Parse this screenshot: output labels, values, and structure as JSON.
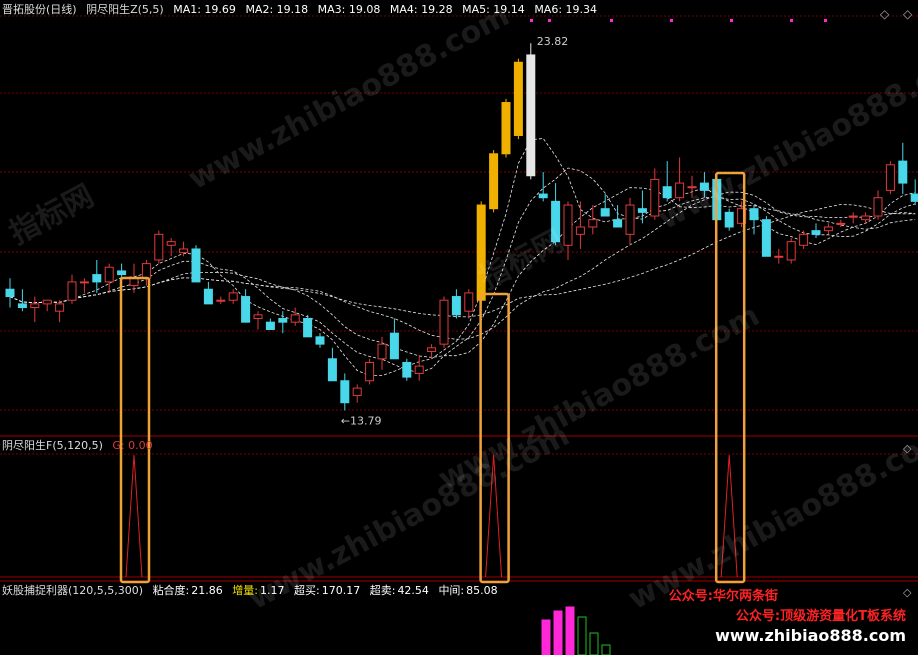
{
  "colors": {
    "up": "#e03a3a",
    "down": "#49d7ea",
    "gold": "#f0b000",
    "white": "#e6e6e6",
    "grid": "#7a0000",
    "box": "#f0a23a",
    "pink": "#ff27d8",
    "green": "#22c022",
    "magenta": "#ff2ad6"
  },
  "main_panel": {
    "title": "晋拓股份(日线)",
    "indicator": "阴尽阳生Z(5,5)",
    "ma": [
      "MA1: 19.69",
      "MA2: 19.18",
      "MA3: 19.08",
      "MA4: 19.28",
      "MA5: 19.14",
      "MA6: 19.34"
    ],
    "high_label": "23.82",
    "low_label": "←13.79"
  },
  "signal_panel": {
    "title": "阴尽阳生F(5,120,5)",
    "value_label": "G: 0.00"
  },
  "bottom_panel": {
    "title": "妖股捕捉利器(120,5,5,300)",
    "stats": [
      {
        "label": "粘合度:",
        "value": "21.86"
      },
      {
        "label": "增量:",
        "value": "1.17"
      },
      {
        "label": "超买:",
        "value": "170.17"
      },
      {
        "label": "超卖:",
        "value": "42.54"
      },
      {
        "label": "中间:",
        "value": "85.08"
      }
    ]
  },
  "promo": {
    "line1": "公众号:华尔两条街",
    "line2": "公众号:顶级游资量化T板系统",
    "line3": "www.zhibiao888.com"
  },
  "watermarks": [
    "www.zhibiao888.com",
    "www.zhibiao888.com",
    "指标网",
    "www.zhibiao888.com",
    "www.zhibiao888.com",
    "指标网",
    "www.zhibiao888.com"
  ],
  "chart_data": {
    "type": "candlestick",
    "y_labels_visible": [
      "23.82",
      "13.79"
    ],
    "candles": [
      {
        "o": 17.1,
        "h": 17.4,
        "l": 16.6,
        "c": 16.9
      },
      {
        "o": 16.7,
        "h": 17.1,
        "l": 16.5,
        "c": 16.6
      },
      {
        "o": 16.6,
        "h": 16.9,
        "l": 16.2,
        "c": 16.7
      },
      {
        "o": 16.7,
        "h": 16.8,
        "l": 16.5,
        "c": 16.8
      },
      {
        "o": 16.5,
        "h": 16.8,
        "l": 16.2,
        "c": 16.7
      },
      {
        "o": 16.8,
        "h": 17.5,
        "l": 16.7,
        "c": 17.3
      },
      {
        "o": 17.3,
        "h": 17.4,
        "l": 17.0,
        "c": 17.3
      },
      {
        "o": 17.5,
        "h": 17.9,
        "l": 17.0,
        "c": 17.3
      },
      {
        "o": 17.3,
        "h": 17.8,
        "l": 17.0,
        "c": 17.7
      },
      {
        "o": 17.6,
        "h": 17.8,
        "l": 17.4,
        "c": 17.5
      },
      {
        "o": 17.2,
        "h": 17.8,
        "l": 17.0,
        "c": 17.4
      },
      {
        "o": 17.4,
        "h": 17.9,
        "l": 17.2,
        "c": 17.8
      },
      {
        "o": 17.9,
        "h": 18.7,
        "l": 17.8,
        "c": 18.6
      },
      {
        "o": 18.3,
        "h": 18.5,
        "l": 18.0,
        "c": 18.4
      },
      {
        "o": 18.1,
        "h": 18.4,
        "l": 18.0,
        "c": 18.2
      },
      {
        "o": 18.2,
        "h": 18.3,
        "l": 17.3,
        "c": 17.3
      },
      {
        "o": 17.1,
        "h": 17.3,
        "l": 16.7,
        "c": 16.7
      },
      {
        "o": 16.8,
        "h": 16.9,
        "l": 16.7,
        "c": 16.8
      },
      {
        "o": 16.8,
        "h": 17.1,
        "l": 16.7,
        "c": 17.0
      },
      {
        "o": 16.9,
        "h": 17.1,
        "l": 16.2,
        "c": 16.2
      },
      {
        "o": 16.3,
        "h": 16.5,
        "l": 16.0,
        "c": 16.4
      },
      {
        "o": 16.2,
        "h": 16.3,
        "l": 16.0,
        "c": 16.0
      },
      {
        "o": 16.3,
        "h": 16.5,
        "l": 15.9,
        "c": 16.2
      },
      {
        "o": 16.2,
        "h": 16.6,
        "l": 16.1,
        "c": 16.4
      },
      {
        "o": 16.3,
        "h": 16.4,
        "l": 15.8,
        "c": 15.8
      },
      {
        "o": 15.8,
        "h": 15.9,
        "l": 15.5,
        "c": 15.6
      },
      {
        "o": 15.2,
        "h": 15.5,
        "l": 14.6,
        "c": 14.6
      },
      {
        "o": 14.6,
        "h": 14.8,
        "l": 13.79,
        "c": 14.0
      },
      {
        "o": 14.2,
        "h": 14.5,
        "l": 14.0,
        "c": 14.4
      },
      {
        "o": 14.6,
        "h": 15.2,
        "l": 14.5,
        "c": 15.1
      },
      {
        "o": 15.2,
        "h": 15.8,
        "l": 14.9,
        "c": 15.6
      },
      {
        "o": 15.9,
        "h": 16.3,
        "l": 15.2,
        "c": 15.2
      },
      {
        "o": 15.1,
        "h": 15.2,
        "l": 14.6,
        "c": 14.7
      },
      {
        "o": 14.8,
        "h": 15.3,
        "l": 14.6,
        "c": 15.0
      },
      {
        "o": 15.4,
        "h": 15.6,
        "l": 15.2,
        "c": 15.5
      },
      {
        "o": 15.6,
        "h": 16.9,
        "l": 15.5,
        "c": 16.8
      },
      {
        "o": 16.9,
        "h": 17.1,
        "l": 16.3,
        "c": 16.4
      },
      {
        "o": 16.5,
        "h": 17.1,
        "l": 16.3,
        "c": 17.0
      },
      {
        "o": 16.8,
        "h": 19.5,
        "l": 16.7,
        "c": 19.4
      },
      {
        "o": 19.3,
        "h": 20.9,
        "l": 19.2,
        "c": 20.8
      },
      {
        "o": 20.8,
        "h": 22.3,
        "l": 20.7,
        "c": 22.2
      },
      {
        "o": 21.3,
        "h": 23.4,
        "l": 21.2,
        "c": 23.3
      },
      {
        "o": 23.5,
        "h": 23.82,
        "l": 20.1,
        "c": 20.2
      },
      {
        "o": 19.7,
        "h": 20.3,
        "l": 19.5,
        "c": 19.6
      },
      {
        "o": 19.5,
        "h": 20.0,
        "l": 18.3,
        "c": 18.4
      },
      {
        "o": 18.3,
        "h": 19.5,
        "l": 17.9,
        "c": 19.4
      },
      {
        "o": 18.6,
        "h": 19.5,
        "l": 18.2,
        "c": 18.8
      },
      {
        "o": 18.8,
        "h": 19.4,
        "l": 18.6,
        "c": 19.0
      },
      {
        "o": 19.3,
        "h": 19.7,
        "l": 19.1,
        "c": 19.1
      },
      {
        "o": 19.0,
        "h": 19.4,
        "l": 18.8,
        "c": 18.8
      },
      {
        "o": 18.6,
        "h": 19.6,
        "l": 18.3,
        "c": 19.4
      },
      {
        "o": 19.3,
        "h": 19.8,
        "l": 18.9,
        "c": 19.2
      },
      {
        "o": 19.1,
        "h": 20.4,
        "l": 19.0,
        "c": 20.1
      },
      {
        "o": 19.9,
        "h": 20.6,
        "l": 19.5,
        "c": 19.6
      },
      {
        "o": 19.6,
        "h": 20.7,
        "l": 19.5,
        "c": 20.0
      },
      {
        "o": 19.9,
        "h": 20.2,
        "l": 19.6,
        "c": 19.9
      },
      {
        "o": 20.0,
        "h": 20.3,
        "l": 19.6,
        "c": 19.8
      },
      {
        "o": 20.1,
        "h": 20.2,
        "l": 19.0,
        "c": 19.0
      },
      {
        "o": 19.2,
        "h": 19.3,
        "l": 18.7,
        "c": 18.8
      },
      {
        "o": 18.9,
        "h": 19.5,
        "l": 18.8,
        "c": 19.3
      },
      {
        "o": 19.3,
        "h": 19.4,
        "l": 18.6,
        "c": 19.0
      },
      {
        "o": 19.0,
        "h": 19.1,
        "l": 18.0,
        "c": 18.0
      },
      {
        "o": 18.0,
        "h": 18.2,
        "l": 17.8,
        "c": 18.0
      },
      {
        "o": 17.9,
        "h": 18.5,
        "l": 17.8,
        "c": 18.4
      },
      {
        "o": 18.3,
        "h": 18.7,
        "l": 18.2,
        "c": 18.6
      },
      {
        "o": 18.7,
        "h": 18.9,
        "l": 18.5,
        "c": 18.6
      },
      {
        "o": 18.7,
        "h": 18.9,
        "l": 18.6,
        "c": 18.8
      },
      {
        "o": 18.9,
        "h": 19.0,
        "l": 18.8,
        "c": 18.9
      },
      {
        "o": 19.1,
        "h": 19.2,
        "l": 18.9,
        "c": 19.1
      },
      {
        "o": 19.0,
        "h": 19.2,
        "l": 18.9,
        "c": 19.1
      },
      {
        "o": 19.1,
        "h": 19.8,
        "l": 19.0,
        "c": 19.6
      },
      {
        "o": 19.8,
        "h": 20.6,
        "l": 19.7,
        "c": 20.5
      },
      {
        "o": 20.6,
        "h": 21.1,
        "l": 19.7,
        "c": 20.0
      },
      {
        "o": 19.7,
        "h": 20.1,
        "l": 19.4,
        "c": 19.5
      }
    ],
    "gold_candle_indices": [
      38,
      39,
      40,
      41
    ],
    "white_candle_indices": [
      42
    ],
    "signal_peaks_at_candle_indices": [
      10,
      39,
      58
    ],
    "bottom_bars": [
      {
        "color": "pink",
        "value": 35
      },
      {
        "color": "pink",
        "value": 44
      },
      {
        "color": "pink",
        "value": 48
      },
      {
        "color": "green",
        "value": 38
      },
      {
        "color": "green",
        "value": 22
      },
      {
        "color": "green",
        "value": 10
      }
    ]
  }
}
